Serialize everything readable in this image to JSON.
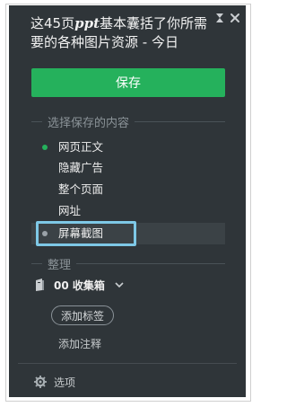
{
  "header": {
    "title_part1": "这45页",
    "title_emphasis": "ppt",
    "title_part2": "基本囊括了你所需要的各种图片资源 - 今日",
    "pin_icon": "pin-icon",
    "close_icon": "close-icon"
  },
  "save_button": {
    "label": "保存"
  },
  "select_section": {
    "heading": "选择保存的内容",
    "options": [
      {
        "label": "网页正文",
        "selected": false,
        "dot_color": "#25b15c"
      },
      {
        "label": "隐藏广告",
        "selected": false
      },
      {
        "label": "整个页面",
        "selected": false
      },
      {
        "label": "网址",
        "selected": false
      },
      {
        "label": "屏幕截图",
        "selected": true,
        "dot_color": "#9aa2a8"
      }
    ]
  },
  "organize_section": {
    "heading": "整理",
    "notebook": {
      "label": "00 收集箱",
      "icon": "notebook-icon"
    },
    "add_tag": "添加标签",
    "add_note": "添加注释"
  },
  "footer": {
    "options_label": "选项",
    "icon": "gear-icon"
  },
  "colors": {
    "panel_bg": "#2f3539",
    "accent_green": "#25b15c",
    "highlight_border": "#7ec8e6"
  }
}
